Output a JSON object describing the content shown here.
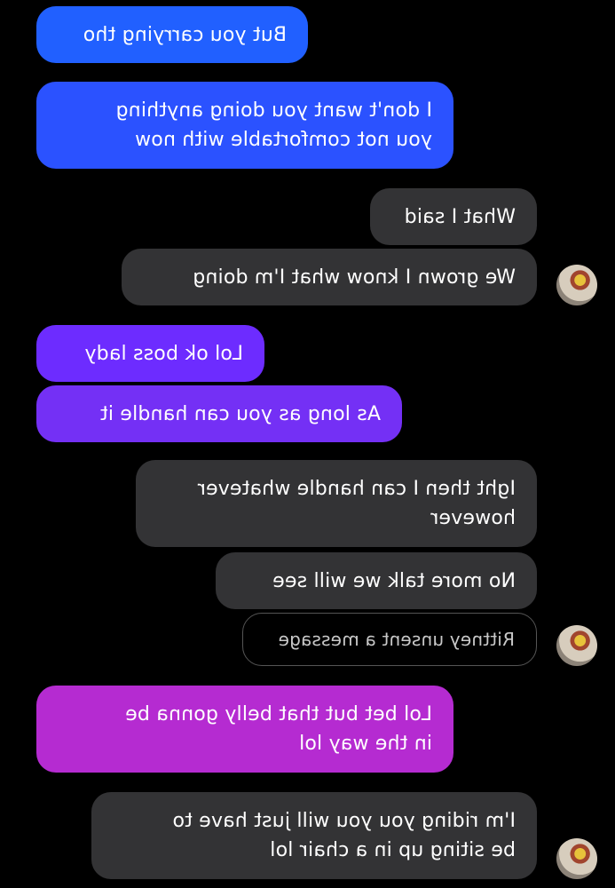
{
  "messages": [
    {
      "side": "out",
      "lines": [
        "But you carrying tho"
      ],
      "color": "#2160ff"
    },
    {
      "side": "out",
      "lines": [
        "I don't want you doing anything",
        "you not comfortable with now"
      ],
      "color": "#2b52ff"
    },
    {
      "side": "in",
      "lines": [
        "What I said"
      ]
    },
    {
      "side": "in",
      "lines": [
        "We grown I know what I'm doing"
      ]
    },
    {
      "side": "out",
      "lines": [
        "Lol ok boss lady"
      ],
      "color": "#6d2cff"
    },
    {
      "side": "out",
      "lines": [
        "As long as you can handle it"
      ],
      "color": "#7430f5"
    },
    {
      "side": "in",
      "lines": [
        "Ight then I can handle whatever",
        "however"
      ]
    },
    {
      "side": "in",
      "lines": [
        "No more talk we will see"
      ]
    },
    {
      "side": "system",
      "lines": [
        "Rittney unsent a message"
      ]
    },
    {
      "side": "out",
      "lines": [
        "Lol bet but that belly gonna be",
        "in the way lol"
      ],
      "color": "#b52bd1"
    },
    {
      "side": "in",
      "lines": [
        "I'm riding you you will just have to",
        "be siting up in a chair lol"
      ]
    }
  ],
  "colors": {
    "background": "#000000",
    "incoming_bubble": "#333335",
    "text": "#ffffff"
  },
  "icons": {
    "avatar": "contact-avatar"
  }
}
